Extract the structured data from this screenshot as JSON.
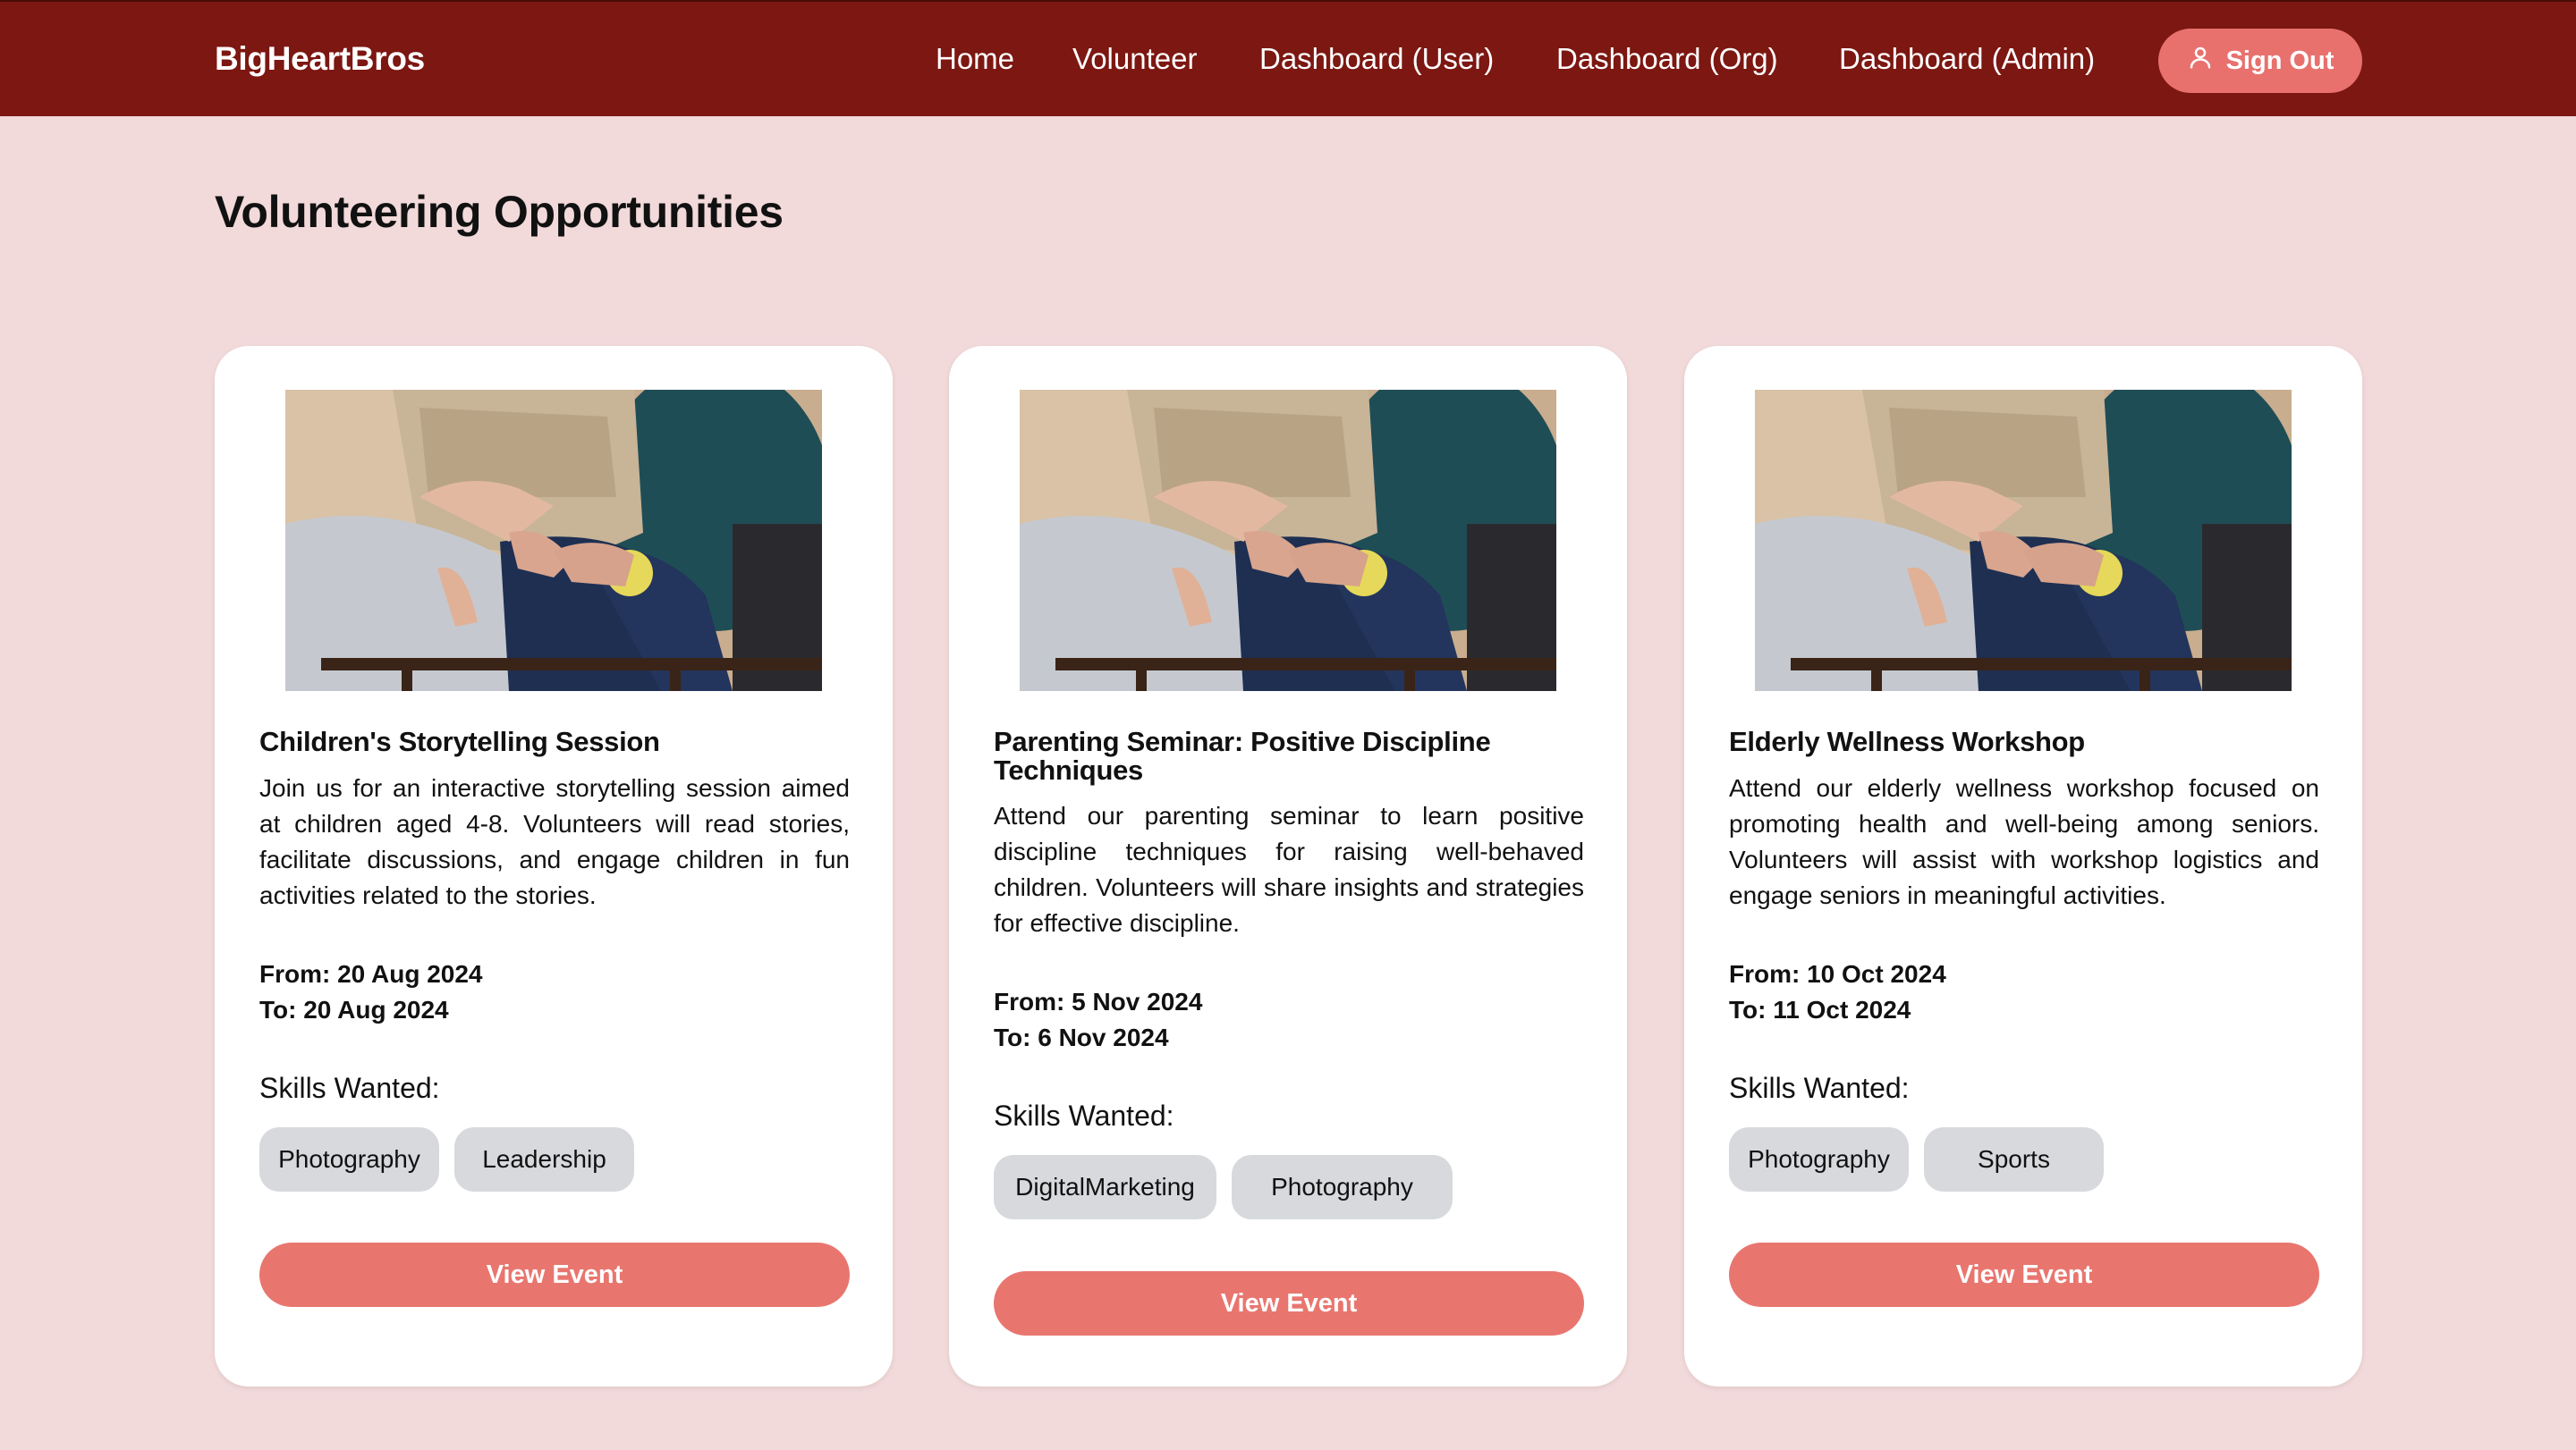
{
  "nav": {
    "brand": "BigHeartBros",
    "links": [
      "Home",
      "Volunteer",
      "Dashboard (User)",
      "Dashboard (Org)",
      "Dashboard (Admin)"
    ],
    "signout_label": "Sign Out",
    "signout_icon": "user-icon"
  },
  "page": {
    "title": "Volunteering Opportunities"
  },
  "common": {
    "skills_label": "Skills Wanted:",
    "view_label": "View Event"
  },
  "colors": {
    "navbar": "#7c1712",
    "background": "#f2d9da",
    "accent": "#e8716e",
    "chip": "#d7d9dd"
  },
  "events": [
    {
      "title": "Children's Storytelling Session",
      "description": "Join us for an interactive storytelling session aimed at children aged 4-8. Volunteers will read stories, facilitate discussions, and engage children in fun activities related to the stories.",
      "from": "From: 20 Aug 2024",
      "to": "To: 20 Aug 2024",
      "skills": [
        "Photography",
        "Leadership"
      ]
    },
    {
      "title": "Parenting Seminar: Positive Discipline Techniques",
      "description": "Attend our parenting seminar to learn positive discipline techniques for raising well-behaved children. Volunteers will share insights and strategies for effective discipline.",
      "from": "From: 5 Nov 2024",
      "to": "To: 6 Nov 2024",
      "skills": [
        "DigitalMarketing",
        "Photography"
      ]
    },
    {
      "title": "Elderly Wellness Workshop",
      "description": "Attend our elderly wellness workshop focused on promoting health and well-being among seniors. Volunteers will assist with workshop logistics and engage seniors in meaningful activities.",
      "from": "From: 10 Oct 2024",
      "to": "To: 11 Oct 2024",
      "skills": [
        "Photography",
        "Sports"
      ]
    }
  ]
}
